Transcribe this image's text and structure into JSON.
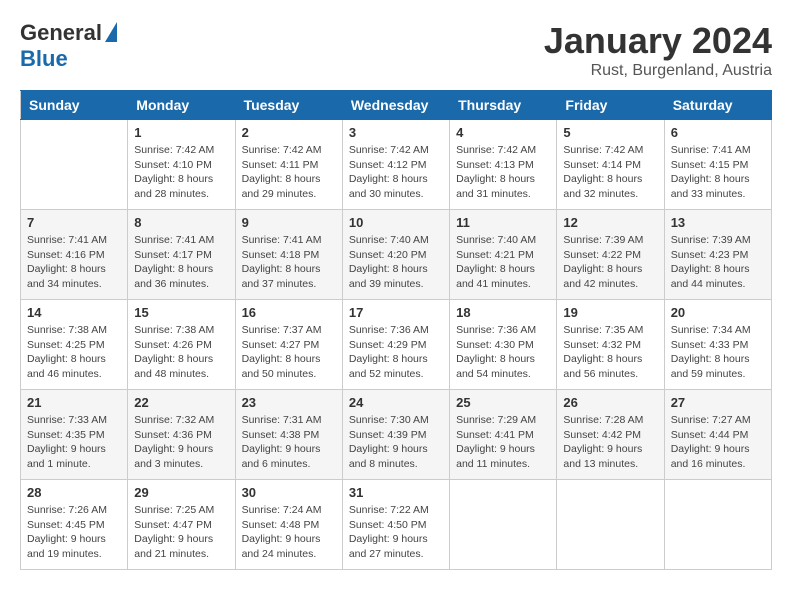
{
  "header": {
    "logo_general": "General",
    "logo_blue": "Blue",
    "month_year": "January 2024",
    "location": "Rust, Burgenland, Austria"
  },
  "weekdays": [
    "Sunday",
    "Monday",
    "Tuesday",
    "Wednesday",
    "Thursday",
    "Friday",
    "Saturday"
  ],
  "weeks": [
    [
      {
        "num": "",
        "sunrise": "",
        "sunset": "",
        "daylight": ""
      },
      {
        "num": "1",
        "sunrise": "Sunrise: 7:42 AM",
        "sunset": "Sunset: 4:10 PM",
        "daylight": "Daylight: 8 hours and 28 minutes."
      },
      {
        "num": "2",
        "sunrise": "Sunrise: 7:42 AM",
        "sunset": "Sunset: 4:11 PM",
        "daylight": "Daylight: 8 hours and 29 minutes."
      },
      {
        "num": "3",
        "sunrise": "Sunrise: 7:42 AM",
        "sunset": "Sunset: 4:12 PM",
        "daylight": "Daylight: 8 hours and 30 minutes."
      },
      {
        "num": "4",
        "sunrise": "Sunrise: 7:42 AM",
        "sunset": "Sunset: 4:13 PM",
        "daylight": "Daylight: 8 hours and 31 minutes."
      },
      {
        "num": "5",
        "sunrise": "Sunrise: 7:42 AM",
        "sunset": "Sunset: 4:14 PM",
        "daylight": "Daylight: 8 hours and 32 minutes."
      },
      {
        "num": "6",
        "sunrise": "Sunrise: 7:41 AM",
        "sunset": "Sunset: 4:15 PM",
        "daylight": "Daylight: 8 hours and 33 minutes."
      }
    ],
    [
      {
        "num": "7",
        "sunrise": "Sunrise: 7:41 AM",
        "sunset": "Sunset: 4:16 PM",
        "daylight": "Daylight: 8 hours and 34 minutes."
      },
      {
        "num": "8",
        "sunrise": "Sunrise: 7:41 AM",
        "sunset": "Sunset: 4:17 PM",
        "daylight": "Daylight: 8 hours and 36 minutes."
      },
      {
        "num": "9",
        "sunrise": "Sunrise: 7:41 AM",
        "sunset": "Sunset: 4:18 PM",
        "daylight": "Daylight: 8 hours and 37 minutes."
      },
      {
        "num": "10",
        "sunrise": "Sunrise: 7:40 AM",
        "sunset": "Sunset: 4:20 PM",
        "daylight": "Daylight: 8 hours and 39 minutes."
      },
      {
        "num": "11",
        "sunrise": "Sunrise: 7:40 AM",
        "sunset": "Sunset: 4:21 PM",
        "daylight": "Daylight: 8 hours and 41 minutes."
      },
      {
        "num": "12",
        "sunrise": "Sunrise: 7:39 AM",
        "sunset": "Sunset: 4:22 PM",
        "daylight": "Daylight: 8 hours and 42 minutes."
      },
      {
        "num": "13",
        "sunrise": "Sunrise: 7:39 AM",
        "sunset": "Sunset: 4:23 PM",
        "daylight": "Daylight: 8 hours and 44 minutes."
      }
    ],
    [
      {
        "num": "14",
        "sunrise": "Sunrise: 7:38 AM",
        "sunset": "Sunset: 4:25 PM",
        "daylight": "Daylight: 8 hours and 46 minutes."
      },
      {
        "num": "15",
        "sunrise": "Sunrise: 7:38 AM",
        "sunset": "Sunset: 4:26 PM",
        "daylight": "Daylight: 8 hours and 48 minutes."
      },
      {
        "num": "16",
        "sunrise": "Sunrise: 7:37 AM",
        "sunset": "Sunset: 4:27 PM",
        "daylight": "Daylight: 8 hours and 50 minutes."
      },
      {
        "num": "17",
        "sunrise": "Sunrise: 7:36 AM",
        "sunset": "Sunset: 4:29 PM",
        "daylight": "Daylight: 8 hours and 52 minutes."
      },
      {
        "num": "18",
        "sunrise": "Sunrise: 7:36 AM",
        "sunset": "Sunset: 4:30 PM",
        "daylight": "Daylight: 8 hours and 54 minutes."
      },
      {
        "num": "19",
        "sunrise": "Sunrise: 7:35 AM",
        "sunset": "Sunset: 4:32 PM",
        "daylight": "Daylight: 8 hours and 56 minutes."
      },
      {
        "num": "20",
        "sunrise": "Sunrise: 7:34 AM",
        "sunset": "Sunset: 4:33 PM",
        "daylight": "Daylight: 8 hours and 59 minutes."
      }
    ],
    [
      {
        "num": "21",
        "sunrise": "Sunrise: 7:33 AM",
        "sunset": "Sunset: 4:35 PM",
        "daylight": "Daylight: 9 hours and 1 minute."
      },
      {
        "num": "22",
        "sunrise": "Sunrise: 7:32 AM",
        "sunset": "Sunset: 4:36 PM",
        "daylight": "Daylight: 9 hours and 3 minutes."
      },
      {
        "num": "23",
        "sunrise": "Sunrise: 7:31 AM",
        "sunset": "Sunset: 4:38 PM",
        "daylight": "Daylight: 9 hours and 6 minutes."
      },
      {
        "num": "24",
        "sunrise": "Sunrise: 7:30 AM",
        "sunset": "Sunset: 4:39 PM",
        "daylight": "Daylight: 9 hours and 8 minutes."
      },
      {
        "num": "25",
        "sunrise": "Sunrise: 7:29 AM",
        "sunset": "Sunset: 4:41 PM",
        "daylight": "Daylight: 9 hours and 11 minutes."
      },
      {
        "num": "26",
        "sunrise": "Sunrise: 7:28 AM",
        "sunset": "Sunset: 4:42 PM",
        "daylight": "Daylight: 9 hours and 13 minutes."
      },
      {
        "num": "27",
        "sunrise": "Sunrise: 7:27 AM",
        "sunset": "Sunset: 4:44 PM",
        "daylight": "Daylight: 9 hours and 16 minutes."
      }
    ],
    [
      {
        "num": "28",
        "sunrise": "Sunrise: 7:26 AM",
        "sunset": "Sunset: 4:45 PM",
        "daylight": "Daylight: 9 hours and 19 minutes."
      },
      {
        "num": "29",
        "sunrise": "Sunrise: 7:25 AM",
        "sunset": "Sunset: 4:47 PM",
        "daylight": "Daylight: 9 hours and 21 minutes."
      },
      {
        "num": "30",
        "sunrise": "Sunrise: 7:24 AM",
        "sunset": "Sunset: 4:48 PM",
        "daylight": "Daylight: 9 hours and 24 minutes."
      },
      {
        "num": "31",
        "sunrise": "Sunrise: 7:22 AM",
        "sunset": "Sunset: 4:50 PM",
        "daylight": "Daylight: 9 hours and 27 minutes."
      },
      {
        "num": "",
        "sunrise": "",
        "sunset": "",
        "daylight": ""
      },
      {
        "num": "",
        "sunrise": "",
        "sunset": "",
        "daylight": ""
      },
      {
        "num": "",
        "sunrise": "",
        "sunset": "",
        "daylight": ""
      }
    ]
  ]
}
